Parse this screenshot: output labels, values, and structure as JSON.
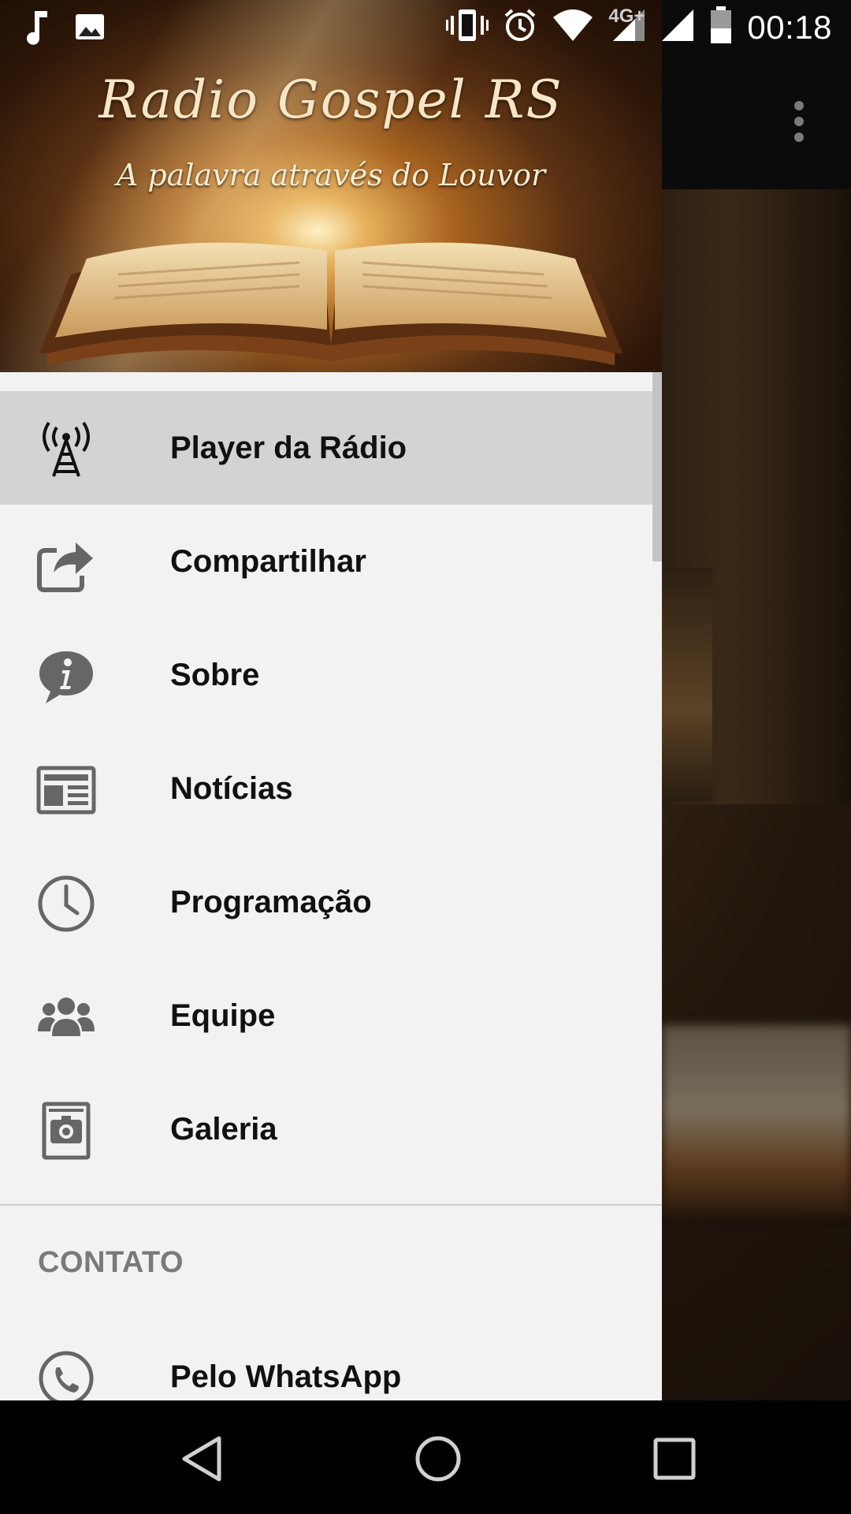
{
  "status_bar": {
    "time": "00:18",
    "network": "4G+",
    "left_icons": [
      "music-note-icon",
      "image-icon"
    ],
    "right_icons": [
      "vibrate-icon",
      "alarm-icon",
      "wifi-icon",
      "signal-icon",
      "signal-icon",
      "battery-icon"
    ]
  },
  "drawer": {
    "header": {
      "title": "Radio Gospel RS",
      "subtitle": "A palavra através do Louvor"
    },
    "items": [
      {
        "label": "Player da Rádio",
        "icon": "radio-tower-icon",
        "active": true
      },
      {
        "label": "Compartilhar",
        "icon": "share-icon",
        "active": false
      },
      {
        "label": "Sobre",
        "icon": "info-icon",
        "active": false
      },
      {
        "label": "Notícias",
        "icon": "newspaper-icon",
        "active": false
      },
      {
        "label": "Programação",
        "icon": "clock-icon",
        "active": false
      },
      {
        "label": "Equipe",
        "icon": "team-icon",
        "active": false
      },
      {
        "label": "Galeria",
        "icon": "gallery-icon",
        "active": false
      }
    ],
    "section": {
      "title": "CONTATO",
      "items": [
        {
          "label": "Pelo WhatsApp",
          "icon": "whatsapp-icon"
        }
      ]
    }
  },
  "nav_bar": {
    "buttons": [
      "back-icon",
      "home-icon",
      "recents-icon"
    ]
  },
  "colors": {
    "drawer_bg": "#f2f2f2",
    "active_item_bg": "#d3d3d3",
    "icon_gray": "#666666"
  }
}
